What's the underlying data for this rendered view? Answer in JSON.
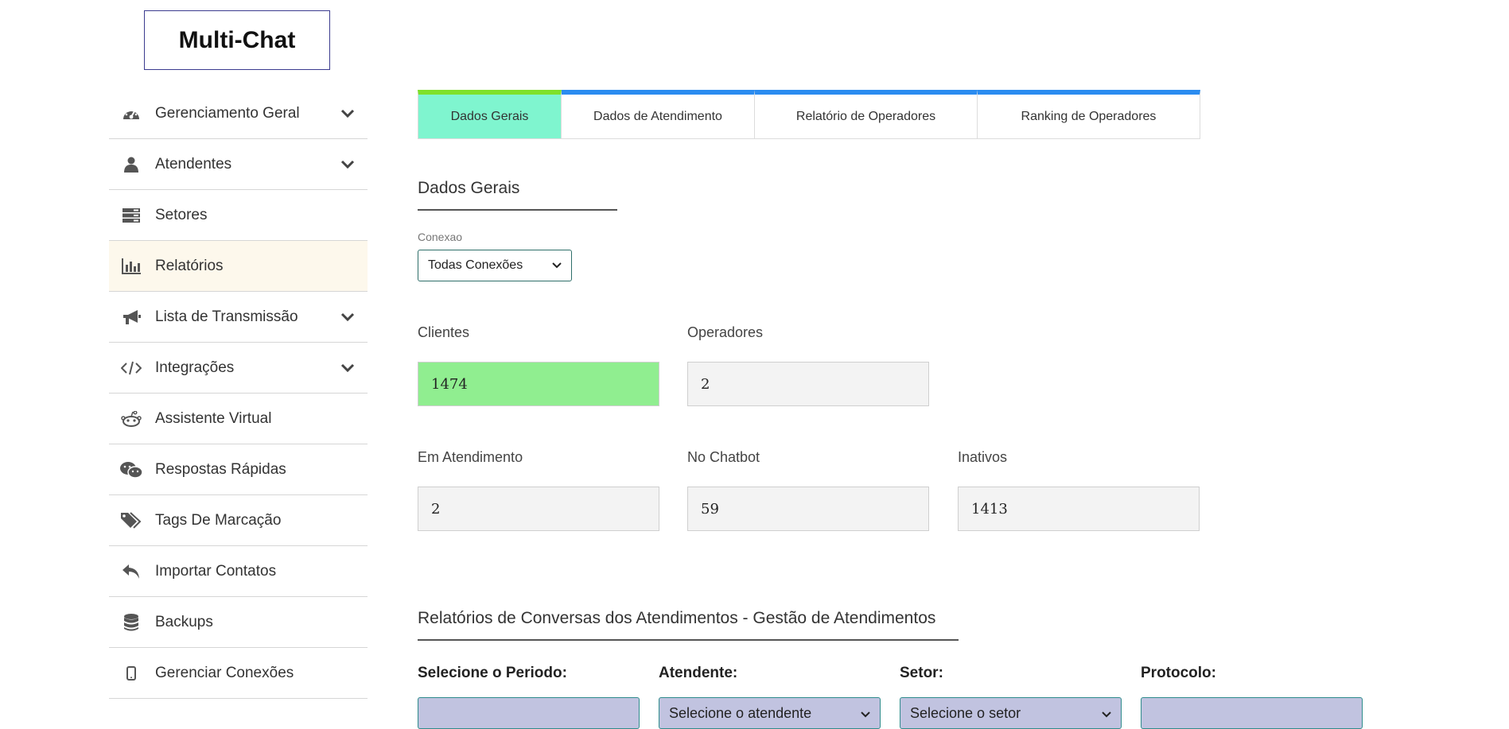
{
  "app": {
    "logo": "Multi-Chat"
  },
  "sidebar": {
    "items": [
      {
        "label": "Gerenciamento Geral",
        "icon": "dashboard-icon",
        "has_chevron": true
      },
      {
        "label": "Atendentes",
        "icon": "user-icon",
        "has_chevron": true
      },
      {
        "label": "Setores",
        "icon": "server-icon",
        "has_chevron": false
      },
      {
        "label": "Relatórios",
        "icon": "bar-chart-icon",
        "has_chevron": false,
        "active": true
      },
      {
        "label": "Lista de Transmissão",
        "icon": "megaphone-icon",
        "has_chevron": true
      },
      {
        "label": "Integrações",
        "icon": "code-icon",
        "has_chevron": true
      },
      {
        "label": "Assistente Virtual",
        "icon": "robot-icon",
        "has_chevron": false
      },
      {
        "label": "Respostas Rápidas",
        "icon": "chat-bubbles-icon",
        "has_chevron": false
      },
      {
        "label": "Tags De Marcação",
        "icon": "tags-icon",
        "has_chevron": false
      },
      {
        "label": "Importar Contatos",
        "icon": "reply-icon",
        "has_chevron": false
      },
      {
        "label": "Backups",
        "icon": "database-icon",
        "has_chevron": false
      },
      {
        "label": "Gerenciar Conexões",
        "icon": "mobile-icon",
        "has_chevron": false
      }
    ]
  },
  "tabs": [
    {
      "label": "Dados Gerais",
      "active": true
    },
    {
      "label": "Dados de Atendimento"
    },
    {
      "label": "Relatório de Operadores"
    },
    {
      "label": "Ranking de Operadores"
    }
  ],
  "general": {
    "title": "Dados Gerais",
    "connection_label": "Conexao",
    "connection_value": "Todas Conexões",
    "stats": {
      "clients": {
        "label": "Clientes",
        "value": "1474"
      },
      "operators": {
        "label": "Operadores",
        "value": "2"
      },
      "in_service": {
        "label": "Em Atendimento",
        "value": "2"
      },
      "chatbot": {
        "label": "No Chatbot",
        "value": "59"
      },
      "inactive": {
        "label": "Inativos",
        "value": "1413"
      }
    }
  },
  "reports": {
    "title": "Relatórios de Conversas dos Atendimentos - Gestão de Atendimentos",
    "period_label": "Selecione o Periodo:",
    "attendant_label": "Atendente:",
    "attendant_value": "Selecione o atendente",
    "sector_label": "Setor:",
    "sector_value": "Selecione o setor",
    "protocol_label": "Protocolo:"
  },
  "colors": {
    "accent_blue": "#2b8cf0",
    "active_tab_bg": "#7ff5cf",
    "active_tab_top": "#7fe12a",
    "clients_bg": "#90ee90",
    "filter_bg": "#c1c3e0"
  }
}
